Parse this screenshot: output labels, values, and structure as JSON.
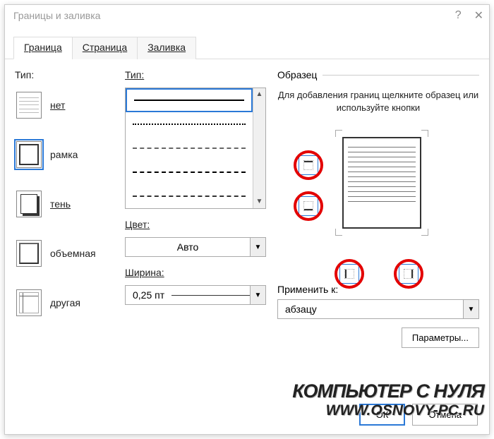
{
  "window": {
    "title": "Границы и заливка",
    "help": "?",
    "close": "✕"
  },
  "tabs": {
    "border": "Граница",
    "page": "Страница",
    "fill": "Заливка"
  },
  "col1": {
    "type_label": "Тип:",
    "none": "нет",
    "box": "рамка",
    "shadow": "тень",
    "threeD": "объемная",
    "custom": "другая"
  },
  "col2": {
    "style_label": "Тип:",
    "color_label": "Цвет:",
    "color_value": "Авто",
    "width_label": "Ширина:",
    "width_value": "0,25 пт"
  },
  "col3": {
    "sample_label": "Образец",
    "hint": "Для добавления границ щелкните образец или используйте кнопки",
    "apply_label": "Применить к:",
    "apply_value": "абзацу",
    "options": "Параметры..."
  },
  "footer": {
    "ok": "ОК",
    "cancel": "Отмена"
  },
  "watermark": {
    "line1": "КОМПЬЮТЕР С НУЛЯ",
    "line2": "WWW.OSNOVY-PC.RU"
  }
}
